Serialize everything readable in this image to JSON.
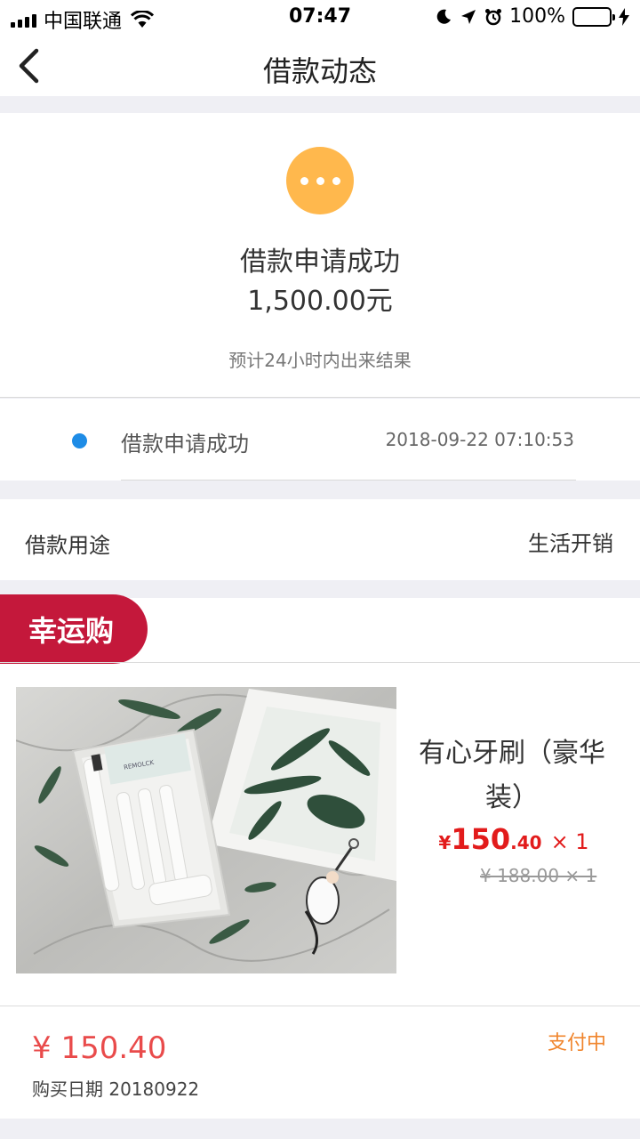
{
  "status_bar": {
    "carrier": "中国联通",
    "time": "07:47",
    "battery": "100%"
  },
  "nav": {
    "title": "借款动态"
  },
  "summary": {
    "title": "借款申请成功",
    "amount": "1,500.00元",
    "hint": "预计24小时内出来结果",
    "status_color": "#ffb84d"
  },
  "timeline": {
    "event": "借款申请成功",
    "time": "2018-09-22 07:10:53",
    "dot_color": "#1e8ce6"
  },
  "purpose": {
    "label": "借款用途",
    "value": "生活开销"
  },
  "order": {
    "tag": "幸运购",
    "tag_color": "#c4183b",
    "product_name": "有心牙刷（豪华装）",
    "price_symbol": "¥",
    "price_integer": "150",
    "price_decimal": ".40",
    "quantity": "× 1",
    "original_price": "¥ 188.00 × 1",
    "total": "¥ 150.40",
    "purchase_date": "购买日期 20180922",
    "payment_status": "支付中",
    "image_brand_text": "REMOLCK"
  }
}
